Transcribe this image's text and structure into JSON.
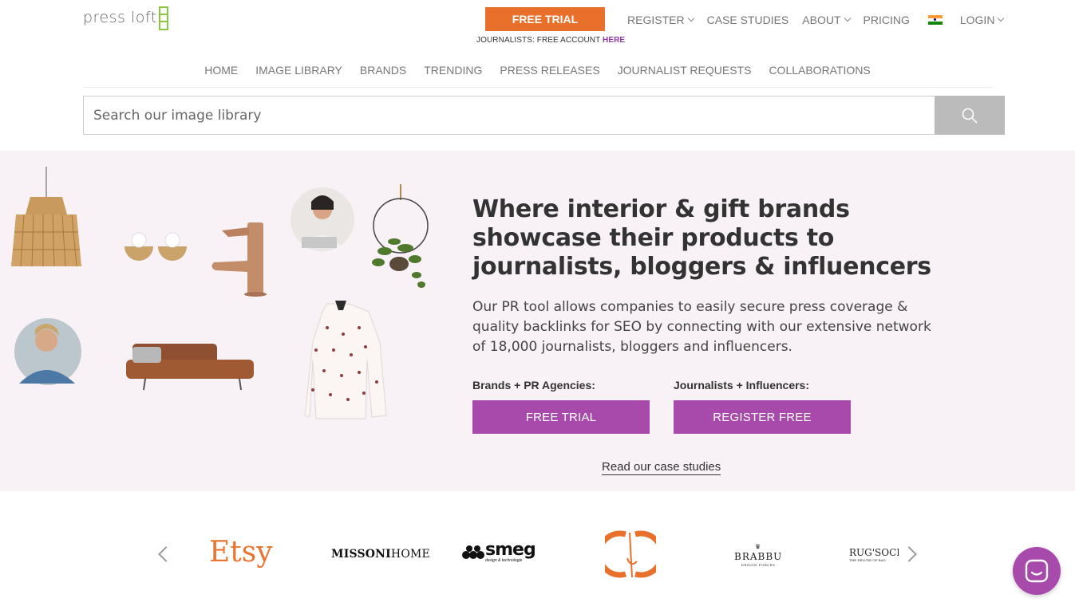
{
  "header": {
    "logo_text": "press loft",
    "free_trial_label": "FREE TRIAL",
    "journalist_note": "JOURNALISTS: FREE ACCOUNT ",
    "journalist_link": "HERE",
    "top_nav": [
      {
        "label": "REGISTER",
        "dropdown": true
      },
      {
        "label": "CASE STUDIES",
        "dropdown": false
      },
      {
        "label": "ABOUT",
        "dropdown": true
      },
      {
        "label": "PRICING",
        "dropdown": false
      }
    ],
    "flag": "india-flag",
    "login_label": "LOGIN"
  },
  "main_nav": [
    "HOME",
    "IMAGE LIBRARY",
    "BRANDS",
    "TRENDING",
    "PRESS RELEASES",
    "JOURNALIST REQUESTS",
    "COLLABORATIONS"
  ],
  "search": {
    "placeholder": "Search our image library",
    "value": ""
  },
  "hero": {
    "title": "Where interior & gift brands showcase their products to journalists, bloggers & influencers",
    "description": "Our PR tool allows companies to easily secure press coverage & quality backlinks for SEO by connecting with our extensive network of 18,000 journalists, bloggers and influencers.",
    "brands_label": "Brands + PR Agencies:",
    "brands_button": "FREE TRIAL",
    "journalists_label": "Journalists + Influencers:",
    "journalists_button": "REGISTER FREE",
    "case_studies_link": "Read our case studies"
  },
  "brand_logos": {
    "etsy": "Etsy",
    "missoni_bold": "MISSONI",
    "missoni_light": "HOME",
    "smeg": "smeg",
    "smeg_tagline": "design & technologie",
    "brabbu": "BRABBU",
    "brabbu_tagline": "DESIGN FORCES",
    "rugsociety": "RUG'SOCIETY",
    "rugsociety_tagline": "THE DELUXE OF RAG"
  },
  "colors": {
    "orange": "#e8702a",
    "purple": "#a74aab",
    "hero_bg": "#f8f2f6",
    "logo_green": "#8cc63f"
  }
}
